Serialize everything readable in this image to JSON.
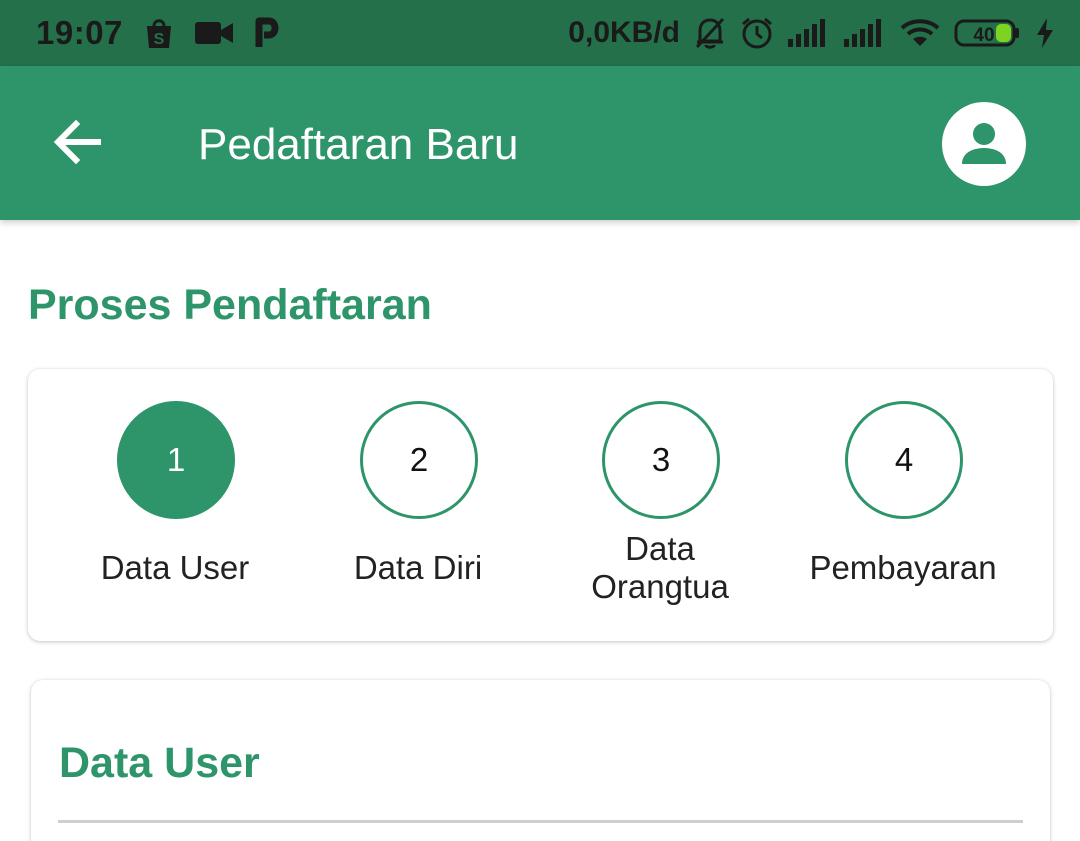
{
  "status_bar": {
    "time": "19:07",
    "network_speed": "0,0KB/d",
    "battery_level": "40",
    "icons": [
      "shopee-icon",
      "video-camera-icon",
      "parking-icon",
      "notification-off-icon",
      "alarm-icon",
      "signal-icon",
      "signal-icon",
      "wifi-icon",
      "battery-icon",
      "charging-icon"
    ]
  },
  "app_bar": {
    "title": "Pedaftaran Baru",
    "back_icon": "arrow-left-icon",
    "profile_icon": "account-icon"
  },
  "section": {
    "title": "Proses Pendaftaran"
  },
  "steps": [
    {
      "number": "1",
      "label": "Data User",
      "active": true
    },
    {
      "number": "2",
      "label": "Data Diri",
      "active": false
    },
    {
      "number": "3",
      "label_line1": "Data",
      "label_line2": "Orangtua",
      "active": false
    },
    {
      "number": "4",
      "label": "Pembayaran",
      "active": false
    }
  ],
  "form_card": {
    "title": "Data User"
  },
  "colors": {
    "primary": "#2d9569",
    "status_bar": "#24704b",
    "battery_fill": "#7ed321"
  }
}
